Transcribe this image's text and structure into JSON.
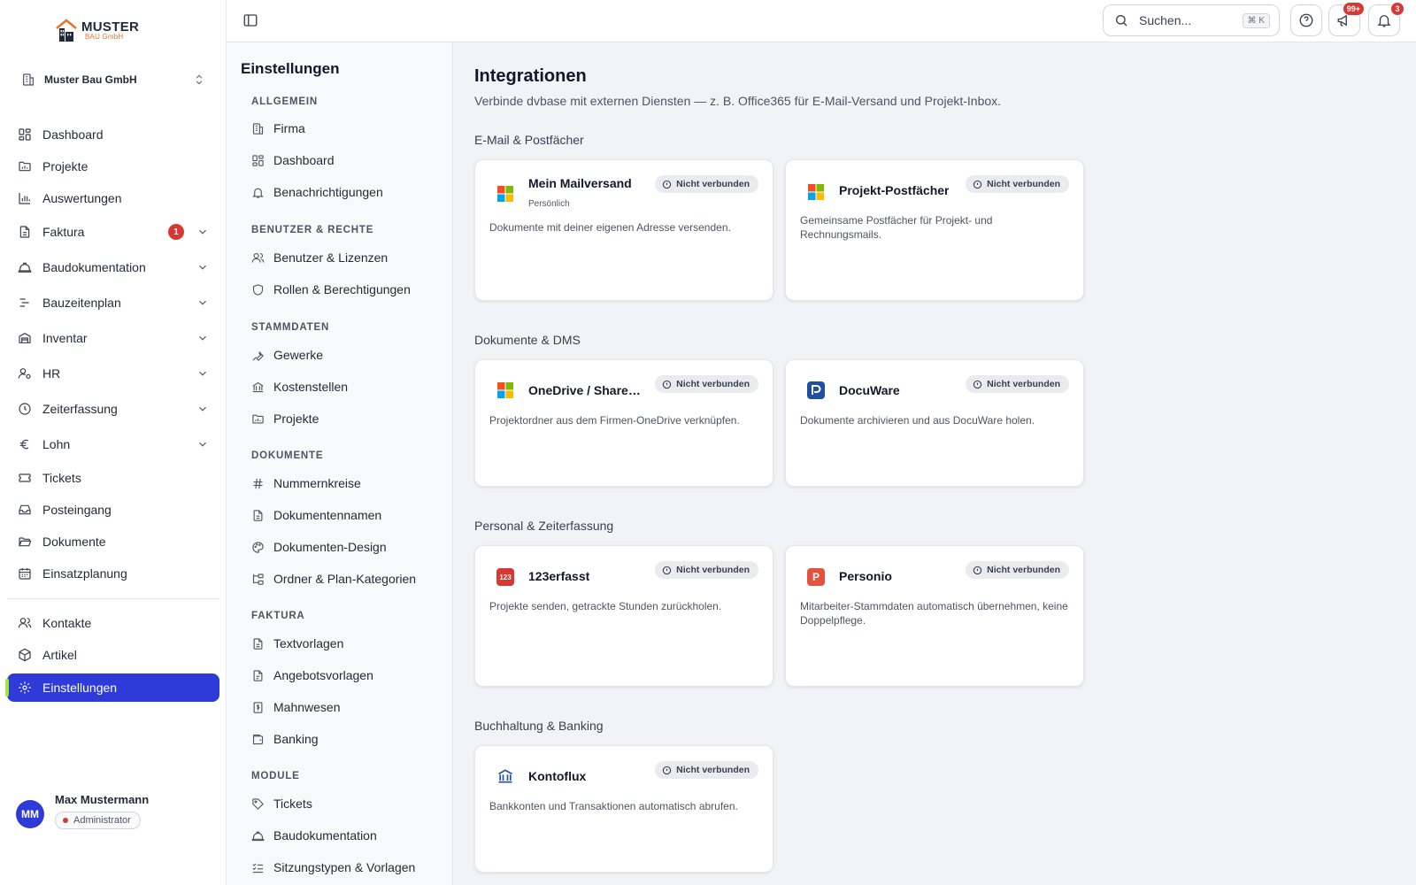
{
  "brand": {
    "name": "MUSTER",
    "sub": "BAU GmbH",
    "accent": "#e8762b"
  },
  "company": {
    "name": "Muster Bau GmbH"
  },
  "nav": {
    "items": [
      {
        "label": "Dashboard"
      },
      {
        "label": "Projekte"
      },
      {
        "label": "Auswertungen"
      },
      {
        "label": "Faktura",
        "badge": "1"
      },
      {
        "label": "Baudokumentation"
      },
      {
        "label": "Bauzeitenplan"
      },
      {
        "label": "Inventar"
      },
      {
        "label": "HR"
      },
      {
        "label": "Zeiterfassung"
      },
      {
        "label": "Lohn"
      },
      {
        "label": "Tickets"
      },
      {
        "label": "Posteingang"
      },
      {
        "label": "Dokumente"
      },
      {
        "label": "Einsatzplanung"
      },
      {
        "label": "Kontakte"
      },
      {
        "label": "Artikel"
      },
      {
        "label": "Einstellungen",
        "active": true
      }
    ]
  },
  "user": {
    "initials": "MM",
    "name": "Max Mustermann",
    "role": "Administrator"
  },
  "topbar": {
    "search_placeholder": "Suchen...",
    "search_shortcut": "⌘ K",
    "announcements_badge": "99+",
    "notifications_badge": "3"
  },
  "settings": {
    "title": "Einstellungen",
    "groups": [
      {
        "title": "Allgemein",
        "items": [
          "Firma",
          "Dashboard",
          "Benachrichtigungen"
        ]
      },
      {
        "title": "Benutzer & Rechte",
        "items": [
          "Benutzer & Lizenzen",
          "Rollen & Berechtigungen"
        ]
      },
      {
        "title": "Stammdaten",
        "items": [
          "Gewerke",
          "Kostenstellen",
          "Projekte"
        ]
      },
      {
        "title": "Dokumente",
        "items": [
          "Nummernkreise",
          "Dokumentennamen",
          "Dokumenten-Design",
          "Ordner & Plan-Kategorien"
        ]
      },
      {
        "title": "Faktura",
        "items": [
          "Textvorlagen",
          "Angebotsvorlagen",
          "Mahnwesen",
          "Banking"
        ]
      },
      {
        "title": "Module",
        "items": [
          "Tickets",
          "Baudokumentation",
          "Sitzungstypen & Vorlagen"
        ]
      }
    ]
  },
  "main": {
    "title": "Integrationen",
    "subtitle": "Verbinde dvbase mit externen Diensten — z. B. Office365 für E-Mail-Versand und Projekt-Inbox.",
    "sections": [
      {
        "title": "E-Mail & Postfächer",
        "cards": [
          {
            "name": "Mein Mailversand",
            "sub": "Persönlich",
            "status": "Nicht verbunden",
            "desc": "Dokumente mit deiner eigenen Adresse versenden."
          },
          {
            "name": "Projekt-Postfächer",
            "status": "Nicht verbunden",
            "desc": "Gemeinsame Postfächer für Projekt- und Rechnungsmails."
          }
        ]
      },
      {
        "title": "Dokumente & DMS",
        "cards": [
          {
            "name": "OneDrive / SharePoint",
            "status": "Nicht verbunden",
            "desc": "Projektordner aus dem Firmen-OneDrive verknüpfen."
          },
          {
            "name": "DocuWare",
            "status": "Nicht verbunden",
            "desc": "Dokumente archivieren und aus DocuWare holen."
          }
        ]
      },
      {
        "title": "Personal & Zeiterfassung",
        "cards": [
          {
            "name": "123erfasst",
            "logo_text": "123",
            "status": "Nicht verbunden",
            "desc": "Projekte senden, getrackte Stunden zurückholen."
          },
          {
            "name": "Personio",
            "logo_text": "P",
            "status": "Nicht verbunden",
            "desc": "Mitarbeiter-Stammdaten automatisch übernehmen, keine Doppelpflege."
          }
        ]
      },
      {
        "title": "Buchhaltung & Banking",
        "cards": [
          {
            "name": "Kontoflux",
            "status": "Nicht verbunden",
            "desc": "Bankkonten und Transaktionen automatisch abrufen."
          }
        ]
      }
    ]
  },
  "colors": {
    "primary": "#2f3bd8",
    "danger": "#d73832",
    "sidebar_indicator": "#a3e635"
  }
}
